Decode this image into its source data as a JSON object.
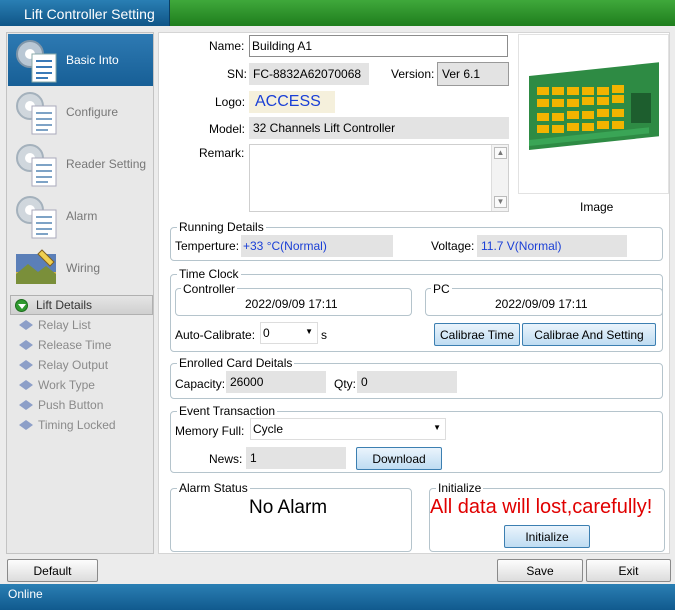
{
  "window": {
    "title": "Lift Controller Setting"
  },
  "sidebar": {
    "items": [
      {
        "label": "Basic Into",
        "icon": "gear-checklist-icon",
        "active": true
      },
      {
        "label": "Configure",
        "icon": "gear-checklist-icon",
        "active": false
      },
      {
        "label": "Reader Setting",
        "icon": "gear-checklist-icon",
        "active": false
      },
      {
        "label": "Alarm",
        "icon": "gear-checklist-icon",
        "active": false
      },
      {
        "label": "Wiring",
        "icon": "landscape-pen-icon",
        "active": false
      }
    ],
    "lift_details": {
      "header": "Lift Details",
      "items": [
        "Relay List",
        "Release Time",
        "Relay Output",
        "Work Type",
        "Push Button",
        "Timing Locked"
      ]
    }
  },
  "basic": {
    "name_label": "Name:",
    "name_value": "Building A1",
    "sn_label": "SN:",
    "sn_value": "FC-8832A62070068",
    "version_label": "Version:",
    "version_value": "Ver 6.1",
    "logo_label": "Logo:",
    "logo_value": "ACCESS",
    "model_label": "Model:",
    "model_value": "32 Channels Lift Controller",
    "remark_label": "Remark:",
    "remark_value": "",
    "image_caption": "Image"
  },
  "running": {
    "title": "Running Details",
    "temp_label": "Temperture:",
    "temp_value": "+33 °C(Normal)",
    "voltage_label": "Voltage:",
    "voltage_value": "11.7 V(Normal)"
  },
  "timeclock": {
    "title": "Time Clock",
    "controller_title": "Controller",
    "controller_time": "2022/09/09 17:11",
    "pc_title": "PC",
    "pc_time": "2022/09/09 17:11",
    "autocal_label": "Auto-Calibrate:",
    "autocal_value": "0",
    "autocal_unit": "s",
    "calibrate_btn": "Calibrae Time",
    "calibrate_setting_btn": "Calibrae And Setting"
  },
  "enrolled": {
    "title": "Enrolled Card Deitals",
    "capacity_label": "Capacity:",
    "capacity_value": "26000",
    "qty_label": "Qty:",
    "qty_value": "0"
  },
  "event": {
    "title": "Event Transaction",
    "memory_label": "Memory Full:",
    "memory_value": "Cycle",
    "news_label": "News:",
    "news_value": "1",
    "download_btn": "Download"
  },
  "alarm": {
    "title": "Alarm Status",
    "value": "No Alarm"
  },
  "initialize": {
    "title": "Initialize",
    "warning": "All data will lost,carefully!",
    "button": "Initialize"
  },
  "footer": {
    "default_btn": "Default",
    "save_btn": "Save",
    "exit_btn": "Exit"
  },
  "status": {
    "text": "Online"
  },
  "colors": {
    "accent_blue": "#1a5f93",
    "title_green": "#2f952c",
    "warning_red": "#e00000",
    "value_blue": "#1a3fd6"
  }
}
